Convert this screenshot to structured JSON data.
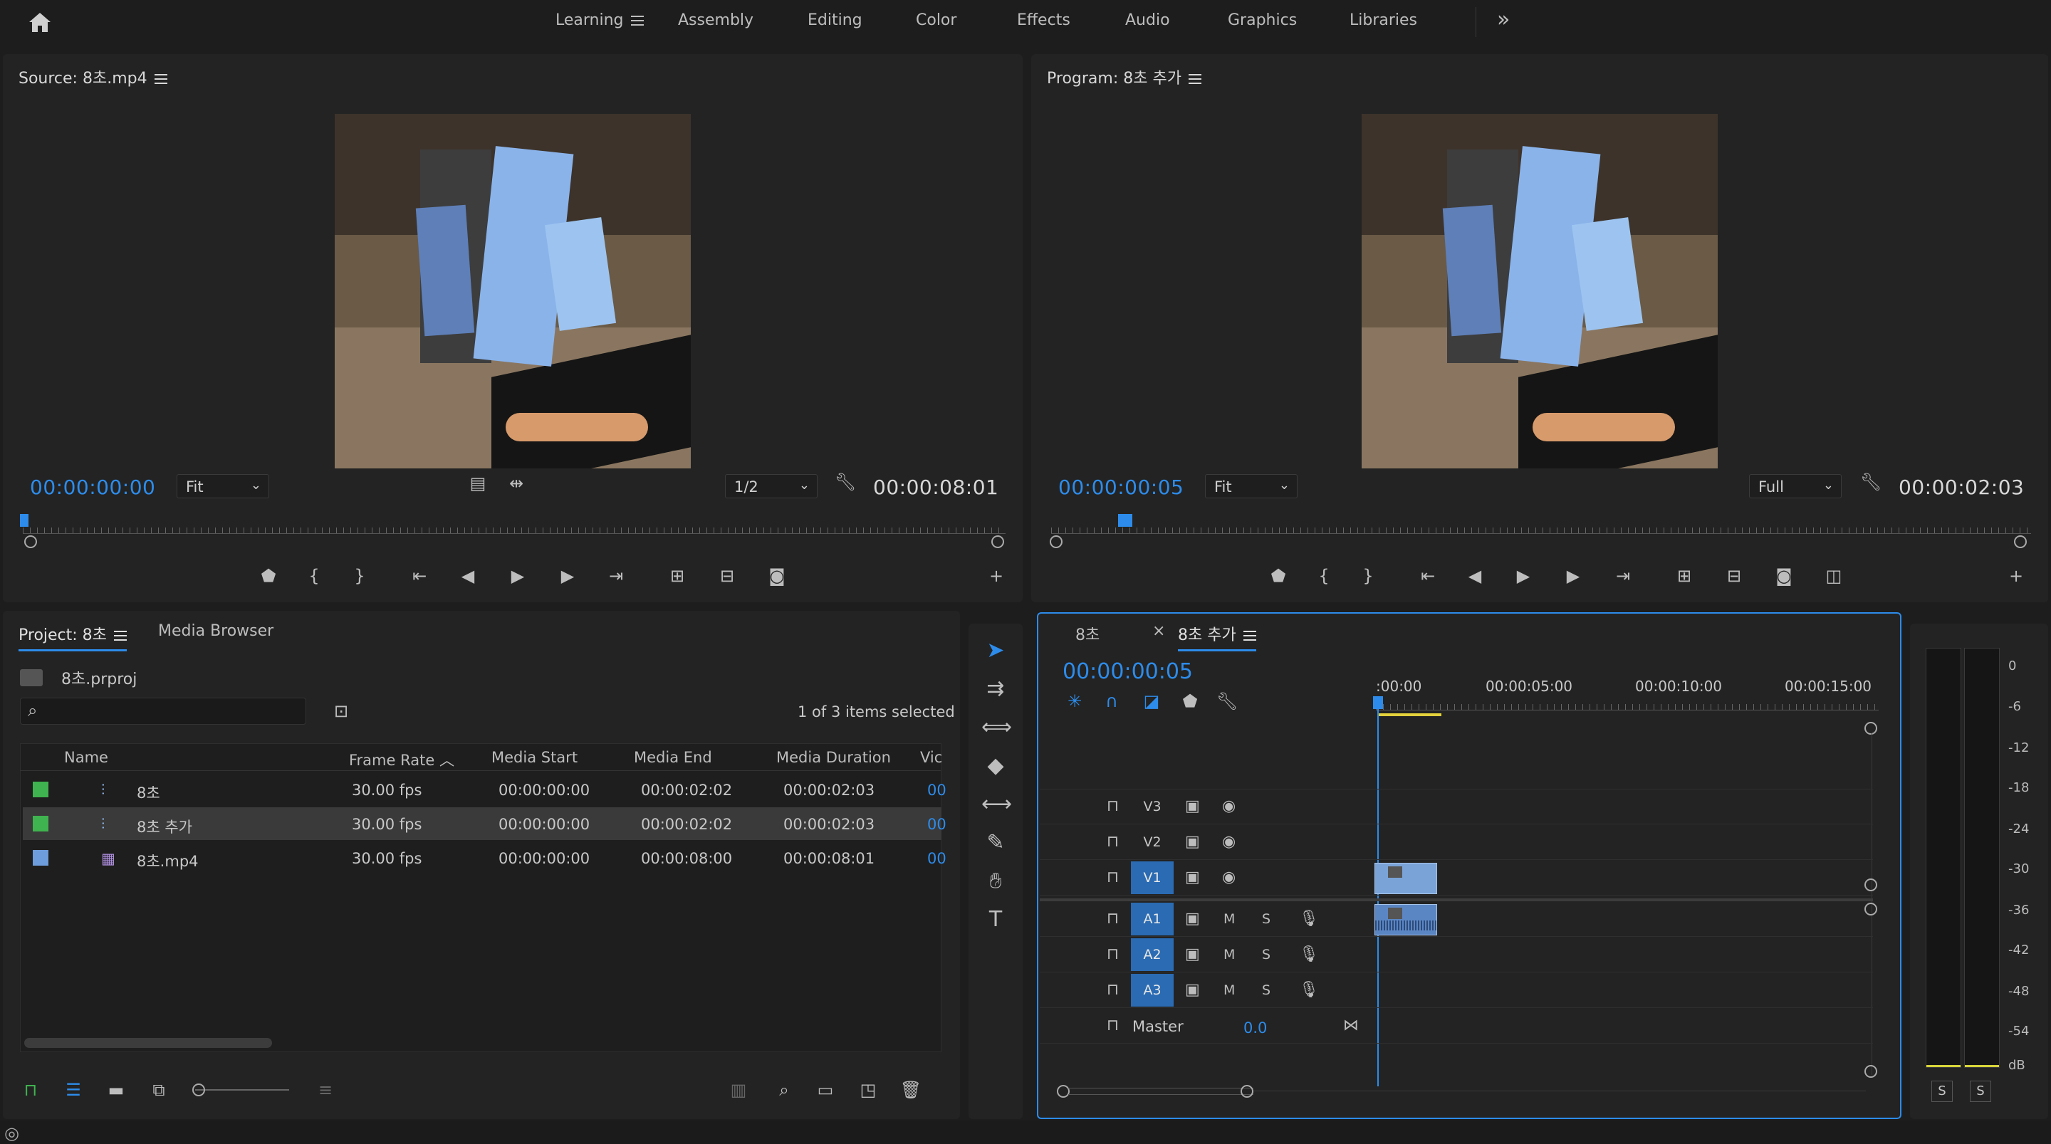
{
  "workspace": {
    "tabs": [
      "Learning",
      "Assembly",
      "Editing",
      "Color",
      "Effects",
      "Audio",
      "Graphics",
      "Libraries"
    ],
    "active": "Learning",
    "more": "»"
  },
  "source": {
    "title": "Source: 8초.mp4",
    "timecode": "00:00:00:00",
    "zoom": "Fit",
    "resolution": "1/2",
    "duration": "00:00:08:01"
  },
  "program": {
    "title": "Program: 8초 추가",
    "timecode": "00:00:00:05",
    "zoom": "Fit",
    "resolution": "Full",
    "duration": "00:00:02:03"
  },
  "project": {
    "tab": "Project: 8초",
    "tab2": "Media Browser",
    "file": "8초.prproj",
    "selection": "1 of 3 items selected",
    "columns": [
      "Name",
      "Frame Rate",
      "Media Start",
      "Media End",
      "Media Duration",
      "Vic"
    ],
    "rows": [
      {
        "name": "8초",
        "fps": "30.00 fps",
        "start": "00:00:00:00",
        "end": "00:00:02:02",
        "dur": "00:00:02:03",
        "vid": "00",
        "color": "#3fb34f"
      },
      {
        "name": "8초 추가",
        "fps": "30.00 fps",
        "start": "00:00:00:00",
        "end": "00:00:02:02",
        "dur": "00:00:02:03",
        "vid": "00",
        "color": "#3fb34f"
      },
      {
        "name": "8초.mp4",
        "fps": "30.00 fps",
        "start": "00:00:00:00",
        "end": "00:00:08:00",
        "dur": "00:00:08:01",
        "vid": "00",
        "color": "#6d9ddc"
      }
    ]
  },
  "timeline": {
    "tab1": "8초",
    "tab2": "8초 추가",
    "timecode": "00:00:00:05",
    "ruler": [
      ":00:00",
      "00:00:05:00",
      "00:00:10:00",
      "00:00:15:00"
    ],
    "video_tracks": [
      "V3",
      "V2",
      "V1"
    ],
    "audio_tracks": [
      "A1",
      "A2",
      "A3"
    ],
    "master": "Master",
    "master_value": "0.0",
    "m": "M",
    "s": "S"
  },
  "meter": {
    "labels": [
      "0",
      "-6",
      "-12",
      "-18",
      "-24",
      "-30",
      "-36",
      "-42",
      "-48",
      "-54",
      "dB"
    ],
    "solo": [
      "S",
      "S"
    ]
  }
}
